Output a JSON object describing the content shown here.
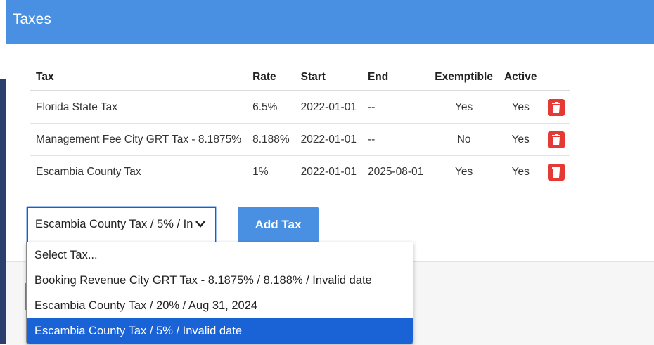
{
  "header": {
    "title": "Taxes"
  },
  "table": {
    "columns": [
      "Tax",
      "Rate",
      "Start",
      "End",
      "Exemptible",
      "Active"
    ],
    "rows": [
      {
        "tax": "Florida State Tax",
        "rate": "6.5%",
        "start": "2022-01-01",
        "end": "--",
        "exemptible": "Yes",
        "active": "Yes"
      },
      {
        "tax": "Management Fee City GRT Tax - 8.1875%",
        "rate": "8.188%",
        "start": "2022-01-01",
        "end": "--",
        "exemptible": "No",
        "active": "Yes"
      },
      {
        "tax": "Escambia County Tax",
        "rate": "1%",
        "start": "2022-01-01",
        "end": "2025-08-01",
        "exemptible": "Yes",
        "active": "Yes"
      }
    ],
    "delete_icon": "trash-icon",
    "delete_color": "#e53935"
  },
  "tax_select": {
    "value": "Escambia County Tax / 5% / Invalid date",
    "options": [
      "Select Tax...",
      "Booking Revenue City GRT Tax - 8.1875% / 8.188% / Invalid date",
      "Escambia County Tax / 20% / Aug 31, 2024",
      "Escambia County Tax / 5% / Invalid date"
    ],
    "selected_index": 3
  },
  "add_button": {
    "label": "Add Tax"
  },
  "colors": {
    "header": "#4a90e2",
    "primary": "#4a90e2",
    "selected_option": "#1a63d6"
  }
}
